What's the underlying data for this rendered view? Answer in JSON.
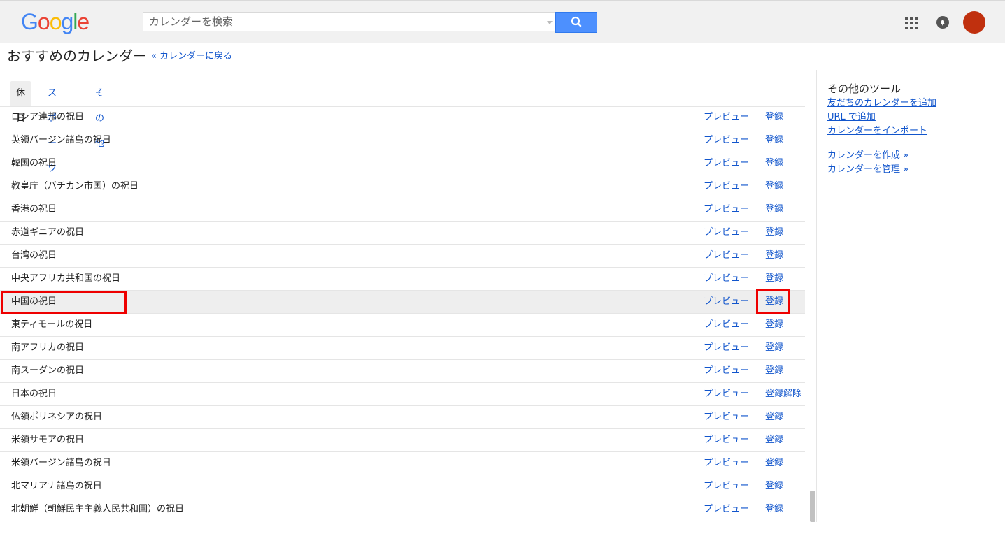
{
  "header": {
    "logo": [
      "G",
      "o",
      "o",
      "g",
      "l",
      "e"
    ],
    "search_placeholder": "カレンダーを検索"
  },
  "page": {
    "title": "おすすめのカレンダー",
    "back_link": "« カレンダーに戻る"
  },
  "tabs": [
    {
      "label": "休日",
      "active": true
    },
    {
      "label": "スポーツ",
      "active": false
    },
    {
      "label": "その他",
      "active": false
    }
  ],
  "rows": [
    {
      "name": "ロシア連邦の祝日",
      "preview": "プレビュー",
      "action": "登録"
    },
    {
      "name": "英領バージン諸島の祝日",
      "preview": "プレビュー",
      "action": "登録"
    },
    {
      "name": "韓国の祝日",
      "preview": "プレビュー",
      "action": "登録"
    },
    {
      "name": "教皇庁（バチカン市国）の祝日",
      "preview": "プレビュー",
      "action": "登録"
    },
    {
      "name": "香港の祝日",
      "preview": "プレビュー",
      "action": "登録"
    },
    {
      "name": "赤道ギニアの祝日",
      "preview": "プレビュー",
      "action": "登録"
    },
    {
      "name": "台湾の祝日",
      "preview": "プレビュー",
      "action": "登録"
    },
    {
      "name": "中央アフリカ共和国の祝日",
      "preview": "プレビュー",
      "action": "登録"
    },
    {
      "name": "中国の祝日",
      "preview": "プレビュー",
      "action": "登録"
    },
    {
      "name": "東ティモールの祝日",
      "preview": "プレビュー",
      "action": "登録"
    },
    {
      "name": "南アフリカの祝日",
      "preview": "プレビュー",
      "action": "登録"
    },
    {
      "name": "南スーダンの祝日",
      "preview": "プレビュー",
      "action": "登録"
    },
    {
      "name": "日本の祝日",
      "preview": "プレビュー",
      "action": "登録解除"
    },
    {
      "name": "仏領ポリネシアの祝日",
      "preview": "プレビュー",
      "action": "登録"
    },
    {
      "name": "米領サモアの祝日",
      "preview": "プレビュー",
      "action": "登録"
    },
    {
      "name": "米領バージン諸島の祝日",
      "preview": "プレビュー",
      "action": "登録"
    },
    {
      "name": "北マリアナ諸島の祝日",
      "preview": "プレビュー",
      "action": "登録"
    },
    {
      "name": "北朝鮮（朝鮮民主主義人民共和国）の祝日",
      "preview": "プレビュー",
      "action": "登録"
    }
  ],
  "sidebar": {
    "title": "その他のツール",
    "links": [
      "友だちのカレンダーを追加",
      "URL で追加",
      "カレンダーをインポート",
      "カレンダーを作成 »",
      "カレンダーを管理 »"
    ]
  },
  "colors": {
    "link": "#1155cc",
    "highlight_border": "#ee0000",
    "avatar": "#c0300e",
    "search_button": "#4d90fe"
  }
}
